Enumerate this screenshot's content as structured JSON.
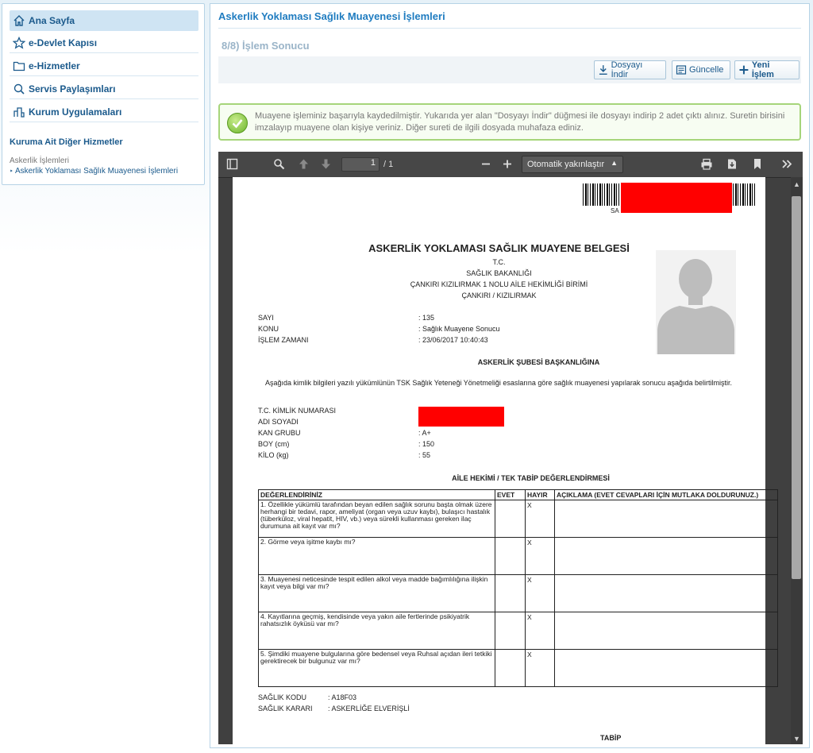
{
  "sidebar": {
    "items": [
      {
        "label": "Ana Sayfa",
        "icon": "home-icon"
      },
      {
        "label": "e-Devlet Kapısı",
        "icon": "star-icon"
      },
      {
        "label": "e-Hizmetler",
        "icon": "folder-icon"
      },
      {
        "label": "Servis Paylaşımları",
        "icon": "search-icon"
      },
      {
        "label": "Kurum Uygulamaları",
        "icon": "building-icon"
      }
    ],
    "section_title": "Kuruma Ait Diğer Hizmetler",
    "breadcrumb_parent": "Askerlik İşlemleri",
    "breadcrumb_child": "Askerlik Yoklaması Sağlık Muayenesi İşlemleri"
  },
  "main": {
    "title": "Askerlik Yoklaması Sağlık Muayenesi İşlemleri",
    "step_title": "8/8) İşlem Sonucu",
    "buttons": {
      "download": "Dosyayı İndir",
      "update": "Güncelle",
      "new": "Yeni İşlem"
    },
    "alert": "Muayene işleminiz başarıyla kaydedilmiştir. Yukarıda yer alan \"Dosyayı İndir\" düğmesi ile dosyayı indirip 2 adet çıktı alınız. Suretin birisini imzalayıp muayene olan kişiye veriniz. Diğer sureti de ilgili dosyada muhafaza ediniz."
  },
  "viewer": {
    "page_current": "1",
    "page_total": "/ 1",
    "zoom": "Otomatik yakınlaştır"
  },
  "doc": {
    "barcode_prefix": "SA",
    "title": "ASKERLİK YOKLAMASI SAĞLIK MUAYENE BELGESİ",
    "header_lines": [
      "T.C.",
      "SAĞLIK BAKANLIĞI",
      "ÇANKIRI KIZILIRMAK 1 NOLU AİLE HEKİMLİĞİ BİRİMİ",
      "ÇANKIRI / KIZILIRMAK"
    ],
    "meta": [
      {
        "label": "SAYI",
        "value": ": 135"
      },
      {
        "label": "KONU",
        "value": ": Sağlık Muayene Sonucu"
      },
      {
        "label": "İŞLEM ZAMANI",
        "value": ": 23/06/2017 10:40:43"
      }
    ],
    "addressee": "ASKERLİK ŞUBESİ BAŞKANLIĞINA",
    "paragraph": "Aşağıda kimlik bilgileri yazılı yükümlünün TSK Sağlık Yeteneği Yönetmeliği esaslarına göre sağlık muayenesi yapılarak sonucu aşağıda belirtilmiştir.",
    "personal": [
      {
        "label": "T.C. KİMLİK NUMARASI",
        "value": ":"
      },
      {
        "label": "ADI SOYADI",
        "value": ":"
      },
      {
        "label": "KAN GRUBU",
        "value": ": A+"
      },
      {
        "label": "BOY (cm)",
        "value": ": 150"
      },
      {
        "label": "KİLO (kg)",
        "value": ": 55"
      }
    ],
    "table_title": "AİLE HEKİMİ / TEK TABİP DEĞERLENDİRMESİ",
    "table_headers": [
      "DEĞERLENDİRİNİZ",
      "EVET",
      "HAYIR",
      "AÇIKLAMA (EVET CEVAPLARI İÇİN MUTLAKA DOLDURUNUZ.)"
    ],
    "rows": [
      {
        "q": "1. Özellikle yükümlü tarafından beyan edilen sağlık sorunu başta olmak üzere herhangi bir tedavi, rapor, ameliyat (organ veya uzuv kaybı), bulaşıcı hastalık (tüberkülоz, viral hepatit, HIV, vb.) veya sürekli kullanması gereken ilaç durumuna ait kayıt var mı?",
        "evet": "",
        "hayir": "X",
        "aciklama": ""
      },
      {
        "q": "2. Görme veya işitme kaybı mı?",
        "evet": "",
        "hayir": "X",
        "aciklama": ""
      },
      {
        "q": "3. Muayenesi neticesinde tespit edilen alkol veya madde bağımlılığına ilişkin kayıt veya bilgi var mı?",
        "evet": "",
        "hayir": "X",
        "aciklama": ""
      },
      {
        "q": "4. Kayıtlarına geçmiş, kendisinde veya yakın aile fertlerinde psikiyatrik rahatsızlık öyküsü var mı?",
        "evet": "",
        "hayir": "X",
        "aciklama": ""
      },
      {
        "q": "5. Şimdiki muayene bulgularına göre bedensel veya Ruhsal açıdan ileri tetkiki gerektirecek bir bulgunuz var mı?",
        "evet": "",
        "hayir": "X",
        "aciklama": ""
      }
    ],
    "footer": [
      {
        "label": "SAĞLIK KODU",
        "value": ": A18F03"
      },
      {
        "label": "SAĞLIK KARARI",
        "value": ": ASKERLİĞE ELVERİŞLİ"
      }
    ],
    "signature": "TABİP"
  }
}
